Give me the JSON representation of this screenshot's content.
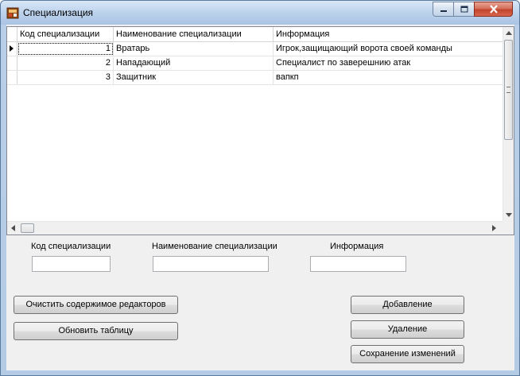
{
  "window": {
    "title": "Специализация"
  },
  "grid": {
    "columns": [
      "Код специализации",
      "Наименование специализации",
      "Информация"
    ],
    "rows": [
      {
        "code": "1",
        "name": "Вратарь",
        "info": "Игрок,защищающий ворота своей команды"
      },
      {
        "code": "2",
        "name": "Нападающий",
        "info": "Специалист по заверешнию атак"
      },
      {
        "code": "3",
        "name": "Защитник",
        "info": "вапкп"
      }
    ]
  },
  "editors": {
    "code_label": "Код специализации",
    "name_label": "Наименование специализации",
    "info_label": "Информация",
    "code_value": "",
    "name_value": "",
    "info_value": ""
  },
  "buttons": {
    "clear": "Очистить содержимое редакторов",
    "refresh": "Обновить таблицу",
    "add": "Добавление",
    "delete": "Удаление",
    "save": "Сохранение изменений"
  },
  "icons": {
    "app": "app-icon",
    "minimize": "minimize-icon",
    "maximize": "maximize-icon",
    "close": "close-icon"
  },
  "colors": {
    "titlebar": "#bcd2ec",
    "close_button": "#c2432b",
    "client": "#f0f0f0"
  }
}
